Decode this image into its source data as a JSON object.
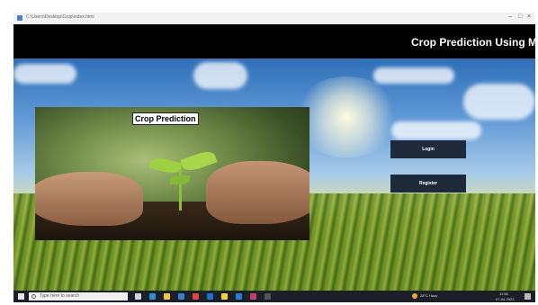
{
  "window": {
    "title_text": "C:\\Users\\Desktop\\Crop\\index.html",
    "controls": [
      "–",
      "□",
      "×"
    ]
  },
  "header": {
    "title": "Crop Prediction Using M"
  },
  "hero": {
    "photo_label": "Crop Prediction"
  },
  "buttons": {
    "login_label": "Login",
    "register_label": "Register"
  },
  "taskbar": {
    "search_placeholder": "Type here to search",
    "weather_text": "28°C  Hazy",
    "time_text": "11:56",
    "date_text": "07-04-2023",
    "apps": [
      {
        "name": "task-view-icon",
        "color": "#cfd6e3"
      },
      {
        "name": "edge-icon",
        "color": "#2a8fd6"
      },
      {
        "name": "file-explorer-icon",
        "color": "#f2c14e"
      },
      {
        "name": "store-icon",
        "color": "#3a7bd5"
      },
      {
        "name": "chrome-icon",
        "color": "#e0463b"
      },
      {
        "name": "mail-icon",
        "color": "#1f6fc7"
      },
      {
        "name": "python-icon",
        "color": "#f4d03f"
      },
      {
        "name": "vscode-icon",
        "color": "#2c7bd8"
      },
      {
        "name": "media-icon",
        "color": "#c43c6a"
      },
      {
        "name": "terminal-icon",
        "color": "#555555"
      }
    ]
  }
}
